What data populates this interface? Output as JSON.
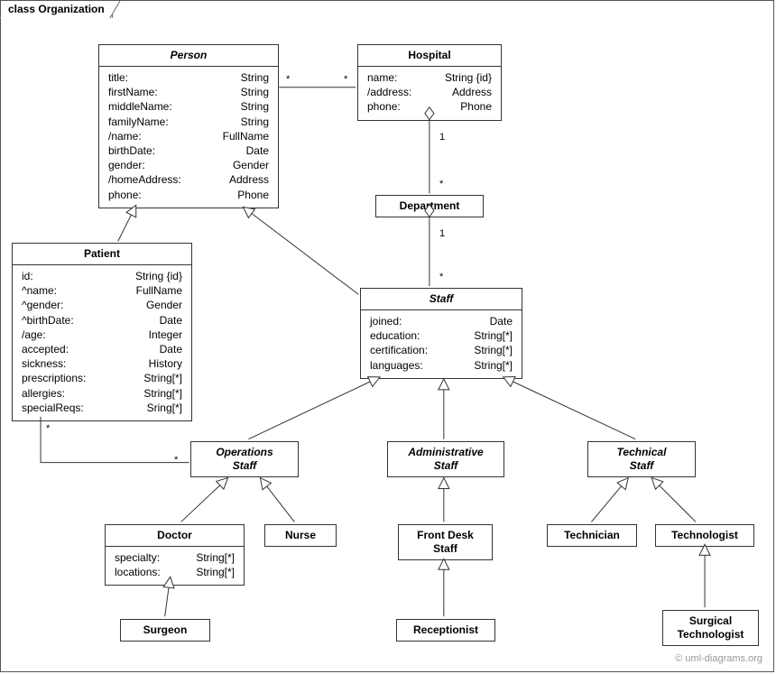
{
  "frame": {
    "label": "class Organization"
  },
  "watermark": "© uml-diagrams.org",
  "classes": {
    "person": {
      "name": "Person",
      "abstract": true,
      "attrs": [
        {
          "k": "title:",
          "v": "String"
        },
        {
          "k": "firstName:",
          "v": "String"
        },
        {
          "k": "middleName:",
          "v": "String"
        },
        {
          "k": "familyName:",
          "v": "String"
        },
        {
          "k": "/name:",
          "v": "FullName"
        },
        {
          "k": "birthDate:",
          "v": "Date"
        },
        {
          "k": "gender:",
          "v": "Gender"
        },
        {
          "k": "/homeAddress:",
          "v": "Address"
        },
        {
          "k": "phone:",
          "v": "Phone"
        }
      ]
    },
    "hospital": {
      "name": "Hospital",
      "abstract": false,
      "attrs": [
        {
          "k": "name:",
          "v": "String {id}"
        },
        {
          "k": "/address:",
          "v": "Address"
        },
        {
          "k": "phone:",
          "v": "Phone"
        }
      ]
    },
    "department": {
      "name": "Department",
      "abstract": false
    },
    "patient": {
      "name": "Patient",
      "abstract": false,
      "attrs": [
        {
          "k": "id:",
          "v": "String {id}"
        },
        {
          "k": "^name:",
          "v": "FullName"
        },
        {
          "k": "^gender:",
          "v": "Gender"
        },
        {
          "k": "^birthDate:",
          "v": "Date"
        },
        {
          "k": "/age:",
          "v": "Integer"
        },
        {
          "k": "accepted:",
          "v": "Date"
        },
        {
          "k": "sickness:",
          "v": "History"
        },
        {
          "k": "prescriptions:",
          "v": "String[*]"
        },
        {
          "k": "allergies:",
          "v": "String[*]"
        },
        {
          "k": "specialReqs:",
          "v": "Sring[*]"
        }
      ]
    },
    "staff": {
      "name": "Staff",
      "abstract": true,
      "attrs": [
        {
          "k": "joined:",
          "v": "Date"
        },
        {
          "k": "education:",
          "v": "String[*]"
        },
        {
          "k": "certification:",
          "v": "String[*]"
        },
        {
          "k": "languages:",
          "v": "String[*]"
        }
      ]
    },
    "opsStaff": {
      "name": "Operations\nStaff",
      "abstract": true
    },
    "adminStaff": {
      "name": "Administrative\nStaff",
      "abstract": true
    },
    "techStaff": {
      "name": "Technical\nStaff",
      "abstract": true
    },
    "doctor": {
      "name": "Doctor",
      "abstract": false,
      "attrs": [
        {
          "k": "specialty:",
          "v": "String[*]"
        },
        {
          "k": "locations:",
          "v": "String[*]"
        }
      ]
    },
    "nurse": {
      "name": "Nurse",
      "abstract": false
    },
    "frontDesk": {
      "name": "Front Desk\nStaff",
      "abstract": false
    },
    "technician": {
      "name": "Technician",
      "abstract": false
    },
    "technologist": {
      "name": "Technologist",
      "abstract": false
    },
    "surgeon": {
      "name": "Surgeon",
      "abstract": false
    },
    "receptionist": {
      "name": "Receptionist",
      "abstract": false
    },
    "surgTech": {
      "name": "Surgical\nTechnologist",
      "abstract": false
    }
  },
  "multiplicities": {
    "personHospL": "*",
    "personHospR": "*",
    "hospDeptTop": "1",
    "hospDeptBot": "*",
    "deptStaffTop": "1",
    "deptStaffBot": "*",
    "patientOpsL": "*",
    "patientOpsR": "*"
  }
}
